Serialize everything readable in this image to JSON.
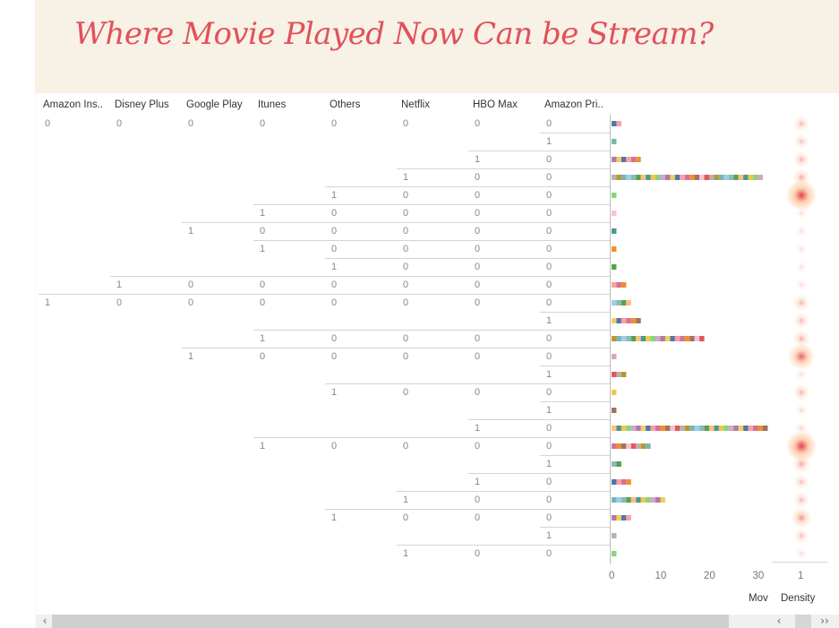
{
  "title": "Where Movie Played Now Can be Stream?",
  "columns": [
    "Amazon Ins..",
    "Disney Plus",
    "Google Play",
    "Itunes",
    "Others",
    "Netflix",
    "HBO Max",
    "Amazon Pri.."
  ],
  "rows": [
    [
      "0",
      "0",
      "0",
      "0",
      "0",
      "0",
      "0",
      "0"
    ],
    [
      "",
      "",
      "",
      "",
      "",
      "",
      "",
      "1"
    ],
    [
      "",
      "",
      "",
      "",
      "",
      "",
      "1",
      "0"
    ],
    [
      "",
      "",
      "",
      "",
      "",
      "1",
      "0",
      "0"
    ],
    [
      "",
      "",
      "",
      "",
      "1",
      "0",
      "0",
      "0"
    ],
    [
      "",
      "",
      "",
      "1",
      "0",
      "0",
      "0",
      "0"
    ],
    [
      "",
      "",
      "1",
      "0",
      "0",
      "0",
      "0",
      "0"
    ],
    [
      "",
      "",
      "",
      "1",
      "0",
      "0",
      "0",
      "0"
    ],
    [
      "",
      "",
      "",
      "",
      "1",
      "0",
      "0",
      "0"
    ],
    [
      "",
      "1",
      "0",
      "0",
      "0",
      "0",
      "0",
      "0"
    ],
    [
      "1",
      "0",
      "0",
      "0",
      "0",
      "0",
      "0",
      "0"
    ],
    [
      "",
      "",
      "",
      "",
      "",
      "",
      "",
      "1"
    ],
    [
      "",
      "",
      "",
      "1",
      "0",
      "0",
      "0",
      "0"
    ],
    [
      "",
      "",
      "1",
      "0",
      "0",
      "0",
      "0",
      "0"
    ],
    [
      "",
      "",
      "",
      "",
      "",
      "",
      "",
      "1"
    ],
    [
      "",
      "",
      "",
      "",
      "1",
      "0",
      "0",
      "0"
    ],
    [
      "",
      "",
      "",
      "",
      "",
      "",
      "",
      "1"
    ],
    [
      "",
      "",
      "",
      "",
      "",
      "",
      "1",
      "0"
    ],
    [
      "",
      "",
      "",
      "1",
      "0",
      "0",
      "0",
      "0"
    ],
    [
      "",
      "",
      "",
      "",
      "",
      "",
      "",
      "1"
    ],
    [
      "",
      "",
      "",
      "",
      "",
      "",
      "1",
      "0"
    ],
    [
      "",
      "",
      "",
      "",
      "",
      "1",
      "0",
      "0"
    ],
    [
      "",
      "",
      "",
      "",
      "1",
      "0",
      "0",
      "0"
    ],
    [
      "",
      "",
      "",
      "",
      "",
      "",
      "",
      "1"
    ],
    [
      "",
      "",
      "",
      "",
      "",
      "1",
      "0",
      "0"
    ]
  ],
  "row_counts": [
    2,
    1,
    6,
    31,
    1,
    1,
    1,
    1,
    1,
    3,
    4,
    6,
    19,
    1,
    3,
    1,
    1,
    32,
    8,
    2,
    4,
    11,
    4,
    1,
    1
  ],
  "bar_axis": {
    "ticks": [
      "0",
      "10",
      "20",
      "30"
    ],
    "max": 35,
    "label": "Mov"
  },
  "density_axis": {
    "ticks": [
      "1"
    ],
    "label": "Density"
  },
  "density_levels": [
    0.25,
    0.2,
    0.28,
    0.32,
    0.95,
    0.05,
    0.04,
    0.04,
    0.04,
    0.05,
    0.28,
    0.25,
    0.3,
    0.75,
    0.05,
    0.28,
    0.08,
    0.12,
    0.95,
    0.35,
    0.22,
    0.25,
    0.45,
    0.22,
    0.06
  ],
  "palette": [
    "#4e79a7",
    "#f28e2b",
    "#e15759",
    "#76b7b2",
    "#59a14f",
    "#edc948",
    "#b07aa1",
    "#ff9da7",
    "#9c755f",
    "#bab0ac",
    "#a0cbe8",
    "#ffbe7d",
    "#8cd17d",
    "#f1ce63",
    "#d37295",
    "#fabfd2",
    "#b6992d",
    "#86bcb6",
    "#499894",
    "#d4a6c8"
  ],
  "colors": {
    "title": "#e0525b",
    "header_band": "#f8f1e6",
    "density_core": "#e8344c",
    "density_halo": "#fbc7a0"
  },
  "scroll_left_icon": "‹",
  "scroll_right_icons": "‹",
  "scroll_next_icon": "››"
}
